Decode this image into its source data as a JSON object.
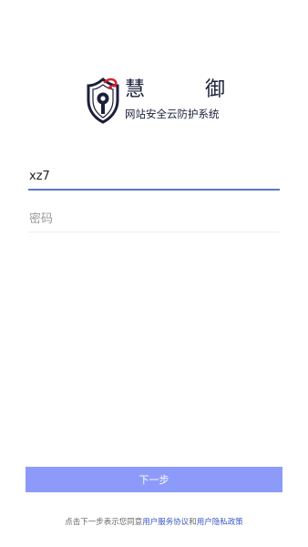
{
  "logo": {
    "title_char_1": "慧",
    "title_char_2": "御",
    "subtitle": "网站安全云防护系统"
  },
  "form": {
    "username_value": "xz7",
    "password_placeholder": "密码"
  },
  "next_button_label": "下一步",
  "agreement": {
    "prefix": "点击下一步表示您同意",
    "link_service": "用户服务协议",
    "joiner": "和",
    "link_privacy": "用户隐私政策"
  },
  "colors": {
    "button": "#8c9bfa",
    "link": "#3b58c6",
    "active_underline": "#5b78c7",
    "logo_dark": "#1c1f3b",
    "logo_red": "#d8232a"
  }
}
